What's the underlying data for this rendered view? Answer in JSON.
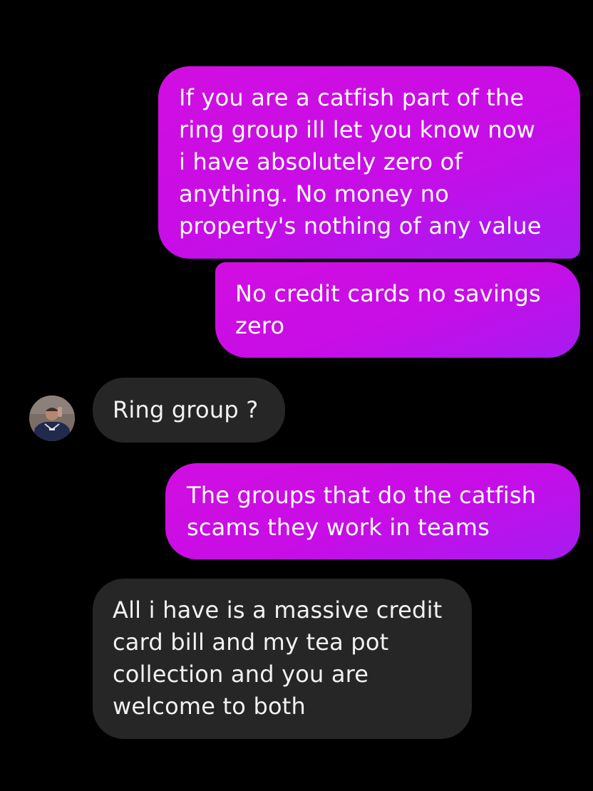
{
  "conversation": {
    "messages": [
      {
        "sender": "me",
        "text": "If you are a catfish part of the\nring group ill let you know now\ni have absolutely zero of\nanything. No money no\nproperty's nothing of any value"
      },
      {
        "sender": "me",
        "text": "No credit cards no savings\nzero"
      },
      {
        "sender": "contact",
        "text": "Ring group ?"
      },
      {
        "sender": "me",
        "text": "The groups that do the catfish\nscams they work in teams"
      },
      {
        "sender": "contact",
        "text": "All i have is a massive credit\ncard bill and my tea pot\ncollection and you are\nwelcome to both"
      }
    ]
  },
  "theme": {
    "background": "#000000",
    "sent_bubble": "#c70de6",
    "received_bubble": "#262626",
    "text": "#ffffff"
  },
  "icons": {
    "contact_avatar": "contact-avatar-photo"
  }
}
